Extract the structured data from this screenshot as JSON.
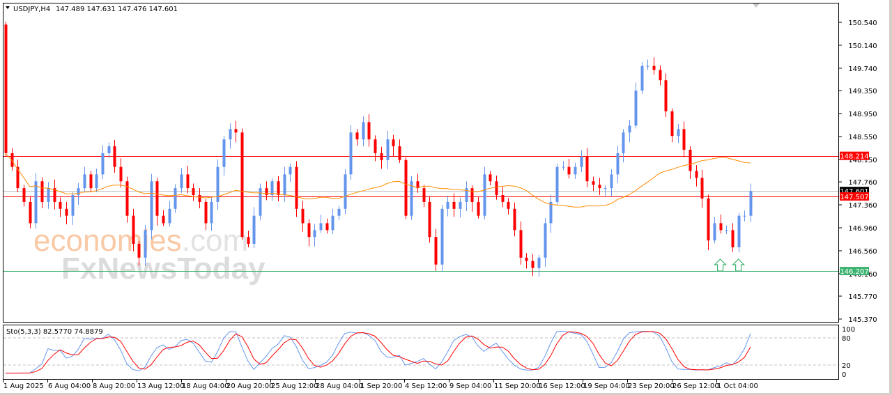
{
  "header": {
    "symbol": "USDJPY,H4",
    "ohlc": "147.489 147.631 147.476 147.601"
  },
  "indicator": {
    "label": "Sto(5,3,3) 82.5770 74.8879",
    "period_k": 5,
    "slowing": 3,
    "period_d": 3,
    "levels": [
      "100",
      "80",
      "20",
      "0"
    ]
  },
  "watermark": {
    "line1": "economies",
    "line1b": ".com",
    "line2": "FxNewsToday"
  },
  "colors": {
    "bull": "#6495ed",
    "bear": "#ff0000",
    "ma": "#ff8c00",
    "support": "#3cb371",
    "sto_main": "#6495ed",
    "sto_signal": "#ff0000"
  },
  "chart_data": {
    "type": "candlestick",
    "title": "USDJPY,H4",
    "ylim": [
      145.37,
      150.54
    ],
    "y_ticks": [
      "150.540",
      "150.140",
      "149.740",
      "149.350",
      "148.950",
      "148.550",
      "148.150",
      "147.760",
      "147.360",
      "146.960",
      "146.560",
      "146.160",
      "145.770",
      "145.370"
    ],
    "x_ticks": [
      "1 Aug 2025",
      "6 Aug 04:00",
      "8 Aug 20:00",
      "13 Aug 12:00",
      "18 Aug 04:00",
      "20 Aug 20:00",
      "25 Aug 12:00",
      "28 Aug 04:00",
      "1 Sep 20:00",
      "4 Sep 12:00",
      "9 Sep 04:00",
      "11 Sep 20:00",
      "16 Sep 12:00",
      "19 Sep 04:00",
      "23 Sep 20:00",
      "26 Sep 12:00",
      "1 Oct 04:00"
    ],
    "first_open": 150.5,
    "closes": [
      148.26,
      148.02,
      147.65,
      147.41,
      147.04,
      147.77,
      147.41,
      147.65,
      147.41,
      147.29,
      147.17,
      147.53,
      147.65,
      147.89,
      147.65,
      147.89,
      148.26,
      148.38,
      148.02,
      147.77,
      147.17,
      146.68,
      146.44,
      146.92,
      147.77,
      147.17,
      147.04,
      147.29,
      147.65,
      147.89,
      147.65,
      147.53,
      147.41,
      147.04,
      147.41,
      148.02,
      148.5,
      148.68,
      148.62,
      146.8,
      146.68,
      147.17,
      147.65,
      147.53,
      147.77,
      147.53,
      147.89,
      148.02,
      147.29,
      147.04,
      146.8,
      146.92,
      147.04,
      146.92,
      147.17,
      147.29,
      147.89,
      148.62,
      148.5,
      148.8,
      148.5,
      148.26,
      148.14,
      148.5,
      148.38,
      148.14,
      147.17,
      147.77,
      147.65,
      147.41,
      146.8,
      146.32,
      147.29,
      147.41,
      147.29,
      147.41,
      147.65,
      147.41,
      147.17,
      147.89,
      147.77,
      147.53,
      147.41,
      147.29,
      146.92,
      146.44,
      146.38,
      146.26,
      146.44,
      147.04,
      147.41,
      148.02,
      148.02,
      147.89,
      148.02,
      148.2,
      147.77,
      147.71,
      147.65,
      147.65,
      147.89,
      148.26,
      148.62,
      148.74,
      149.35,
      149.78,
      149.78,
      149.71,
      149.53,
      148.99,
      148.56,
      148.68,
      148.32,
      147.95,
      147.83,
      147.47,
      146.74,
      147.04,
      146.92,
      146.92,
      146.62,
      147.17,
      147.17,
      147.6
    ],
    "ma_period": 30,
    "levels": [
      {
        "name": "resistance",
        "price": 148.214,
        "label": "148.214",
        "color": "#ff0000"
      },
      {
        "name": "current-price",
        "price": 147.601,
        "label": "147.601",
        "color": "#000000"
      },
      {
        "name": "pivot",
        "price": 147.507,
        "label": "147.507",
        "color": "#ff0000"
      },
      {
        "name": "support",
        "price": 146.207,
        "label": "146.207",
        "color": "#3cb371"
      }
    ],
    "annotations": [
      {
        "type": "up-arrow",
        "candle": 118
      },
      {
        "type": "up-arrow",
        "candle": 121
      }
    ]
  }
}
